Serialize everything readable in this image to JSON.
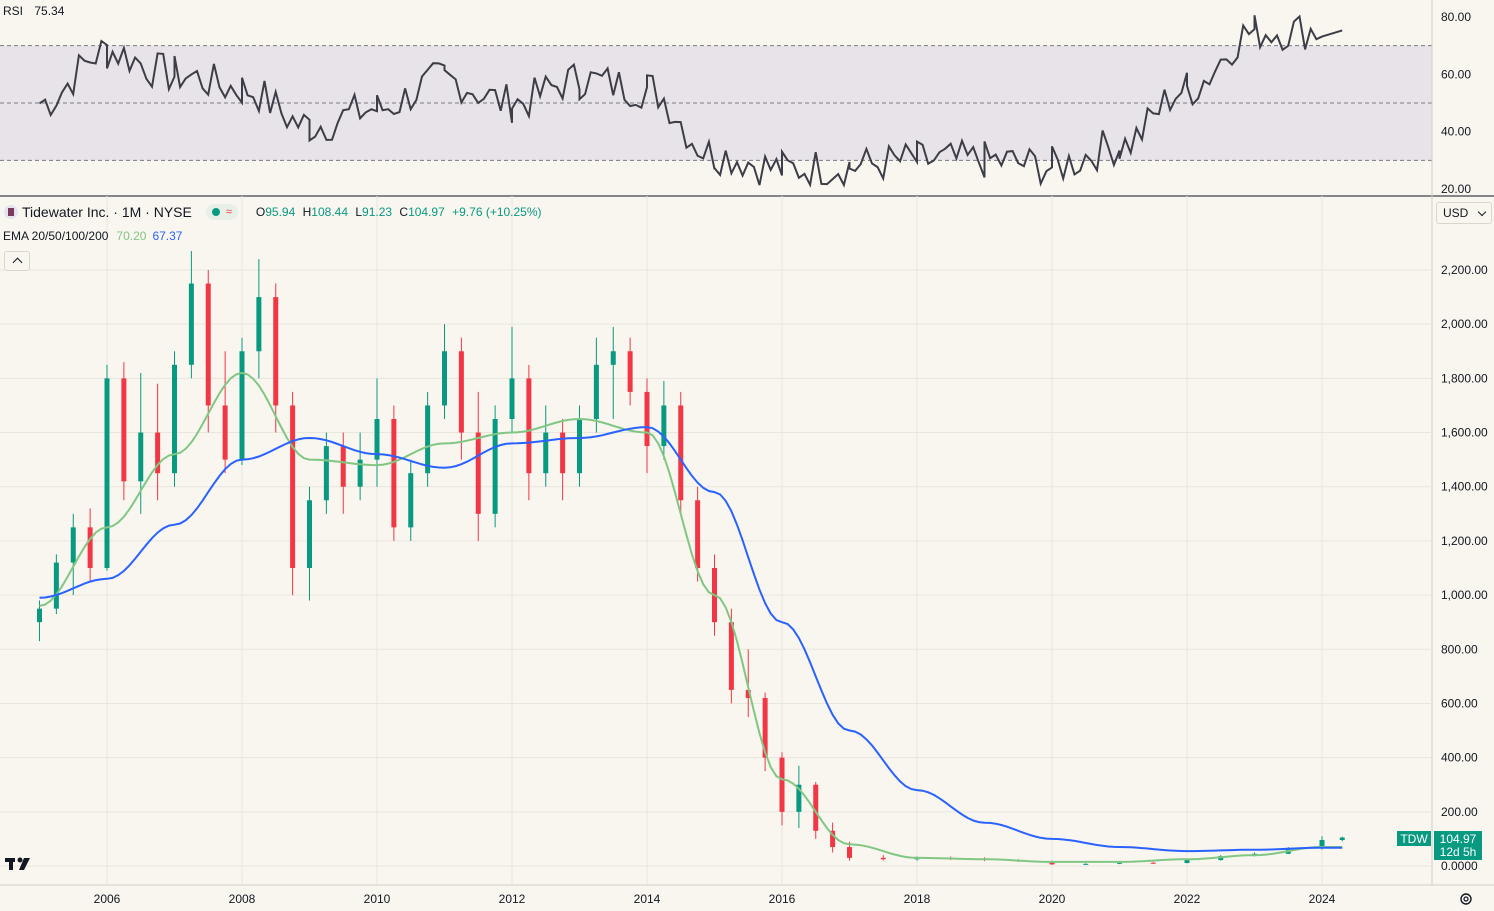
{
  "rsi_panel": {
    "label": "RSI",
    "value": "75.34",
    "axis_ticks": [
      "80.00",
      "60.00",
      "40.00",
      "20.00"
    ]
  },
  "legend": {
    "symbol_title": "Tidewater Inc. · 1M · NYSE",
    "ohlc": {
      "o_label": "O",
      "o": "95.94",
      "h_label": "H",
      "h": "108.44",
      "l_label": "L",
      "l": "91.23",
      "c_label": "C",
      "c": "104.97",
      "change": "+9.76 (+10.25%)"
    },
    "ema_label": "EMA 20/50/100/200",
    "ema_values": [
      "70.20",
      "67.37"
    ]
  },
  "currency": "USD",
  "price_axis_ticks": [
    "2,200.00",
    "2,000.00",
    "1,800.00",
    "1,600.00",
    "1,400.00",
    "1,200.00",
    "1,000.00",
    "800.00",
    "600.00",
    "400.00",
    "200.00",
    "0.0000"
  ],
  "last_price_tag": {
    "ticker": "TDW",
    "price": "104.97",
    "countdown": "12d 5h"
  },
  "time_axis": [
    "2006",
    "2008",
    "2010",
    "2012",
    "2014",
    "2016",
    "2018",
    "2020",
    "2022",
    "2024"
  ],
  "colors": {
    "up": "#089981",
    "down": "#f23645",
    "ema_fast": "#81c784",
    "ema_slow": "#2962ff",
    "rsi_line": "#3d3d47",
    "rsi_band": "#e8e3e8"
  },
  "chart_data": {
    "type": "candlestick",
    "price_range": [
      0,
      2200
    ],
    "rsi_range": [
      20,
      80
    ],
    "rsi_levels": [
      70,
      50,
      30
    ],
    "rsi_last": 75.34,
    "series": [
      {
        "name": "EMA 20",
        "values_by_year": {
          "2005": 960,
          "2006": 1250,
          "2007": 1520,
          "2008": 1820,
          "2009": 1500,
          "2010": 1480,
          "2011": 1560,
          "2012": 1600,
          "2013": 1650,
          "2014": 1600,
          "2015": 1000,
          "2016": 320,
          "2017": 80,
          "2018": 30,
          "2019": 25,
          "2020": 15,
          "2021": 15,
          "2022": 25,
          "2023": 40,
          "2024": 70.2
        }
      },
      {
        "name": "EMA 50",
        "values_by_year": {
          "2005": 990,
          "2006": 1060,
          "2007": 1260,
          "2008": 1500,
          "2009": 1580,
          "2010": 1520,
          "2011": 1470,
          "2012": 1560,
          "2013": 1580,
          "2014": 1620,
          "2015": 1380,
          "2016": 900,
          "2017": 500,
          "2018": 280,
          "2019": 160,
          "2020": 100,
          "2021": 70,
          "2022": 55,
          "2023": 60,
          "2024": 67.37
        }
      }
    ],
    "rsi_by_year": {
      "2005": 50,
      "2006": 68,
      "2007": 60,
      "2008": 55,
      "2009": 42,
      "2010": 48,
      "2011": 58,
      "2012": 50,
      "2013": 58,
      "2014": 55,
      "2015": 32,
      "2016": 27,
      "2017": 28,
      "2018": 30,
      "2019": 30,
      "2020": 28,
      "2021": 35,
      "2022": 55,
      "2023": 75,
      "2024": 75.34
    },
    "candles": [
      {
        "t": 2005.0,
        "o": 900,
        "h": 980,
        "l": 830,
        "c": 950
      },
      {
        "t": 2005.25,
        "o": 950,
        "h": 1150,
        "l": 930,
        "c": 1120
      },
      {
        "t": 2005.5,
        "o": 1120,
        "h": 1300,
        "l": 1000,
        "c": 1250
      },
      {
        "t": 2005.75,
        "o": 1250,
        "h": 1320,
        "l": 1050,
        "c": 1100
      },
      {
        "t": 2006.0,
        "o": 1100,
        "h": 1850,
        "l": 1090,
        "c": 1800
      },
      {
        "t": 2006.25,
        "o": 1800,
        "h": 1860,
        "l": 1350,
        "c": 1420
      },
      {
        "t": 2006.5,
        "o": 1420,
        "h": 1820,
        "l": 1300,
        "c": 1600
      },
      {
        "t": 2006.75,
        "o": 1600,
        "h": 1780,
        "l": 1350,
        "c": 1450
      },
      {
        "t": 2007.0,
        "o": 1450,
        "h": 1900,
        "l": 1400,
        "c": 1850
      },
      {
        "t": 2007.25,
        "o": 1850,
        "h": 2270,
        "l": 1800,
        "c": 2150
      },
      {
        "t": 2007.5,
        "o": 2150,
        "h": 2200,
        "l": 1600,
        "c": 1700
      },
      {
        "t": 2007.75,
        "o": 1700,
        "h": 1900,
        "l": 1450,
        "c": 1500
      },
      {
        "t": 2008.0,
        "o": 1500,
        "h": 1950,
        "l": 1480,
        "c": 1900
      },
      {
        "t": 2008.25,
        "o": 1900,
        "h": 2240,
        "l": 1800,
        "c": 2100
      },
      {
        "t": 2008.5,
        "o": 2100,
        "h": 2150,
        "l": 1600,
        "c": 1700
      },
      {
        "t": 2008.75,
        "o": 1700,
        "h": 1750,
        "l": 1000,
        "c": 1100
      },
      {
        "t": 2009.0,
        "o": 1100,
        "h": 1400,
        "l": 980,
        "c": 1350
      },
      {
        "t": 2009.25,
        "o": 1350,
        "h": 1600,
        "l": 1300,
        "c": 1550
      },
      {
        "t": 2009.5,
        "o": 1550,
        "h": 1600,
        "l": 1300,
        "c": 1400
      },
      {
        "t": 2009.75,
        "o": 1400,
        "h": 1600,
        "l": 1350,
        "c": 1500
      },
      {
        "t": 2010.0,
        "o": 1500,
        "h": 1800,
        "l": 1400,
        "c": 1650
      },
      {
        "t": 2010.25,
        "o": 1650,
        "h": 1700,
        "l": 1200,
        "c": 1250
      },
      {
        "t": 2010.5,
        "o": 1250,
        "h": 1500,
        "l": 1200,
        "c": 1450
      },
      {
        "t": 2010.75,
        "o": 1450,
        "h": 1750,
        "l": 1400,
        "c": 1700
      },
      {
        "t": 2011.0,
        "o": 1700,
        "h": 2000,
        "l": 1650,
        "c": 1900
      },
      {
        "t": 2011.25,
        "o": 1900,
        "h": 1950,
        "l": 1500,
        "c": 1600
      },
      {
        "t": 2011.5,
        "o": 1600,
        "h": 1750,
        "l": 1200,
        "c": 1300
      },
      {
        "t": 2011.75,
        "o": 1300,
        "h": 1700,
        "l": 1250,
        "c": 1650
      },
      {
        "t": 2012.0,
        "o": 1650,
        "h": 1990,
        "l": 1600,
        "c": 1800
      },
      {
        "t": 2012.25,
        "o": 1800,
        "h": 1850,
        "l": 1350,
        "c": 1450
      },
      {
        "t": 2012.5,
        "o": 1450,
        "h": 1700,
        "l": 1400,
        "c": 1600
      },
      {
        "t": 2012.75,
        "o": 1600,
        "h": 1650,
        "l": 1350,
        "c": 1450
      },
      {
        "t": 2013.0,
        "o": 1450,
        "h": 1700,
        "l": 1400,
        "c": 1650
      },
      {
        "t": 2013.25,
        "o": 1650,
        "h": 1950,
        "l": 1600,
        "c": 1850
      },
      {
        "t": 2013.5,
        "o": 1850,
        "h": 1990,
        "l": 1650,
        "c": 1900
      },
      {
        "t": 2013.75,
        "o": 1900,
        "h": 1950,
        "l": 1700,
        "c": 1750
      },
      {
        "t": 2014.0,
        "o": 1750,
        "h": 1800,
        "l": 1450,
        "c": 1550
      },
      {
        "t": 2014.25,
        "o": 1550,
        "h": 1790,
        "l": 1500,
        "c": 1700
      },
      {
        "t": 2014.5,
        "o": 1700,
        "h": 1750,
        "l": 1300,
        "c": 1350
      },
      {
        "t": 2014.75,
        "o": 1350,
        "h": 1400,
        "l": 1050,
        "c": 1100
      },
      {
        "t": 2015.0,
        "o": 1100,
        "h": 1150,
        "l": 850,
        "c": 900
      },
      {
        "t": 2015.25,
        "o": 900,
        "h": 950,
        "l": 600,
        "c": 650
      },
      {
        "t": 2015.5,
        "o": 650,
        "h": 800,
        "l": 550,
        "c": 620
      },
      {
        "t": 2015.75,
        "o": 620,
        "h": 640,
        "l": 350,
        "c": 400
      },
      {
        "t": 2016.0,
        "o": 400,
        "h": 420,
        "l": 150,
        "c": 200
      },
      {
        "t": 2016.25,
        "o": 200,
        "h": 370,
        "l": 140,
        "c": 300
      },
      {
        "t": 2016.5,
        "o": 300,
        "h": 310,
        "l": 100,
        "c": 130
      },
      {
        "t": 2016.75,
        "o": 130,
        "h": 160,
        "l": 50,
        "c": 70
      },
      {
        "t": 2017.0,
        "o": 70,
        "h": 90,
        "l": 20,
        "c": 30
      },
      {
        "t": 2017.5,
        "o": 30,
        "h": 40,
        "l": 20,
        "c": 25
      },
      {
        "t": 2018.0,
        "o": 25,
        "h": 35,
        "l": 20,
        "c": 30
      },
      {
        "t": 2018.5,
        "o": 30,
        "h": 35,
        "l": 22,
        "c": 28
      },
      {
        "t": 2019.0,
        "o": 28,
        "h": 32,
        "l": 18,
        "c": 22
      },
      {
        "t": 2019.5,
        "o": 22,
        "h": 25,
        "l": 15,
        "c": 18
      },
      {
        "t": 2020.0,
        "o": 18,
        "h": 20,
        "l": 4,
        "c": 6
      },
      {
        "t": 2020.5,
        "o": 6,
        "h": 10,
        "l": 4,
        "c": 8
      },
      {
        "t": 2021.0,
        "o": 8,
        "h": 14,
        "l": 7,
        "c": 12
      },
      {
        "t": 2021.5,
        "o": 12,
        "h": 15,
        "l": 9,
        "c": 11
      },
      {
        "t": 2022.0,
        "o": 11,
        "h": 25,
        "l": 10,
        "c": 22
      },
      {
        "t": 2022.5,
        "o": 22,
        "h": 40,
        "l": 20,
        "c": 37
      },
      {
        "t": 2023.0,
        "o": 37,
        "h": 50,
        "l": 35,
        "c": 45
      },
      {
        "t": 2023.5,
        "o": 45,
        "h": 70,
        "l": 44,
        "c": 65
      },
      {
        "t": 2024.0,
        "o": 65,
        "h": 110,
        "l": 60,
        "c": 95.94
      },
      {
        "t": 2024.3,
        "o": 95.94,
        "h": 108.44,
        "l": 91.23,
        "c": 104.97
      }
    ]
  }
}
